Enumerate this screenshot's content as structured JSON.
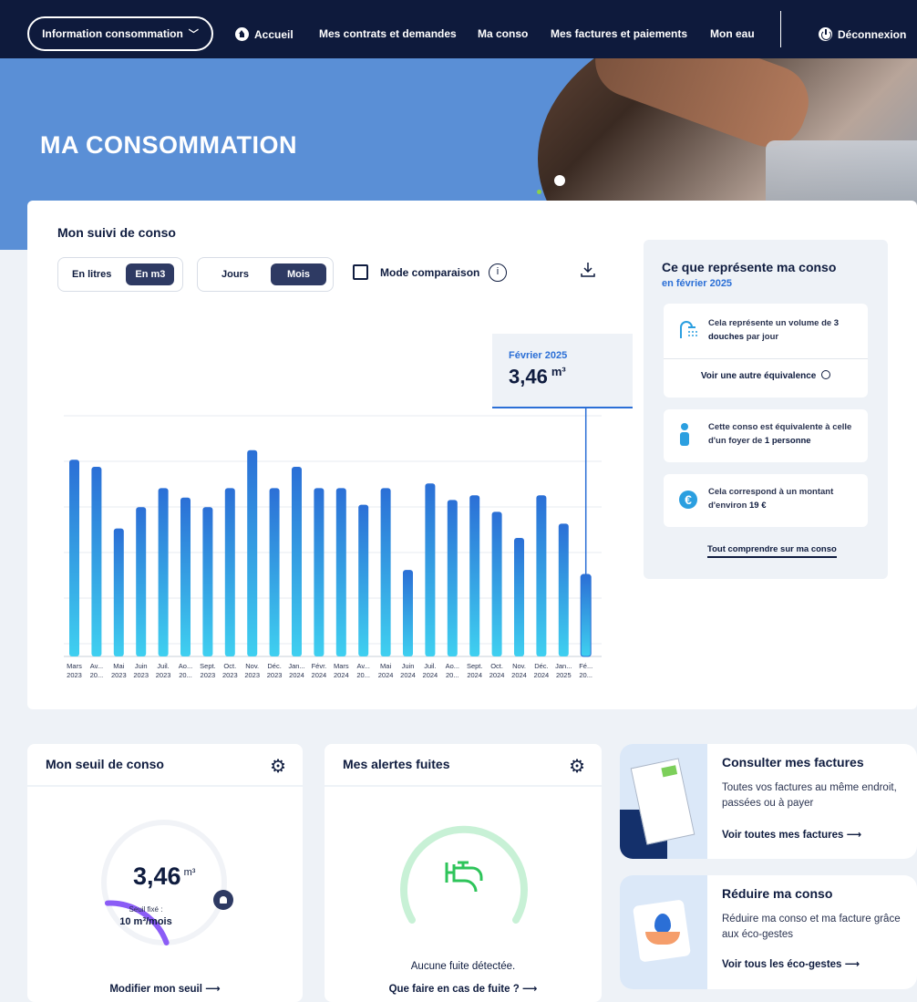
{
  "nav": {
    "info_consommation": "Information consommation",
    "accueil": "Accueil",
    "contrats": "Mes contrats et demandes",
    "ma_conso": "Ma conso",
    "factures": "Mes factures et paiements",
    "mon_eau": "Mon eau",
    "deconnexion": "Déconnexion"
  },
  "hero": {
    "title": "MA CONSOMMATION"
  },
  "suivi": {
    "title": "Mon suivi de conso",
    "unit_toggle": [
      "En litres",
      "En m3"
    ],
    "unit_selected": "En m3",
    "period_toggle": [
      "Jours",
      "Mois"
    ],
    "period_selected": "Mois",
    "comparaison_label": "Mode comparaison",
    "comparaison_checked": false,
    "tooltip": {
      "label": "Février 2025",
      "value": "3,46",
      "unit": "m³"
    }
  },
  "chart_data": {
    "type": "bar",
    "categories": [
      "Mars 2023",
      "Av... 20...",
      "Mai 2023",
      "Juin 2023",
      "Juil. 2023",
      "Ao... 20...",
      "Sept. 2023",
      "Oct. 2023",
      "Nov. 2023",
      "Déc. 2023",
      "Jan... 2024",
      "Févr. 2024",
      "Mars 2024",
      "Av... 20...",
      "Mai 2024",
      "Juin 2024",
      "Juil. 2024",
      "Ao... 20...",
      "Sept. 2024",
      "Oct. 2024",
      "Nov. 2024",
      "Déc. 2024",
      "Jan... 2025",
      "Fé... 20..."
    ],
    "tick_line1": [
      "Mars",
      "Av...",
      "Mai",
      "Juin",
      "Juil.",
      "Ao...",
      "Sept.",
      "Oct.",
      "Nov.",
      "Déc.",
      "Jan...",
      "Févr.",
      "Mars",
      "Av...",
      "Mai",
      "Juin",
      "Juil.",
      "Ao...",
      "Sept.",
      "Oct.",
      "Nov.",
      "Déc.",
      "Jan...",
      "Fé..."
    ],
    "tick_line2": [
      "2023",
      "20...",
      "2023",
      "2023",
      "2023",
      "20...",
      "2023",
      "2023",
      "2023",
      "2023",
      "2024",
      "2024",
      "2024",
      "20...",
      "2024",
      "2024",
      "2024",
      "20...",
      "2024",
      "2024",
      "2024",
      "2024",
      "2025",
      "20..."
    ],
    "values": [
      8.3,
      8.0,
      5.4,
      6.3,
      7.1,
      6.7,
      6.3,
      7.1,
      8.7,
      7.1,
      8.0,
      7.1,
      7.1,
      6.4,
      7.1,
      3.65,
      7.3,
      6.6,
      6.8,
      6.1,
      5.0,
      6.8,
      5.6,
      3.46
    ],
    "highlight_index": 23,
    "ylim": [
      0,
      10
    ],
    "grid": true,
    "colors": {
      "top": "#2b6fd6",
      "bottom": "#3fd0f0"
    }
  },
  "side": {
    "title": "Ce que représente ma conso",
    "subtitle": "en février 2025",
    "eq1_pre": "Cela représente un volume de ",
    "eq1_bold": "3 douches",
    "eq1_post": " par jour",
    "eq1_link": "Voir une autre équivalence",
    "eq2_pre": "Cette conso est équivalente à celle d'un foyer de ",
    "eq2_bold": "1 personne",
    "eq3_pre": "Cela correspond à un montant d'environ ",
    "eq3_bold": "19 €",
    "tout_link": "Tout comprendre sur ma conso"
  },
  "seuil": {
    "title": "Mon seuil de conso",
    "value": "3,46",
    "unit": "m³",
    "seuil_label": "Seuil fixé :",
    "seuil_value": "10 m³/mois",
    "link": "Modifier mon seuil",
    "fraction": 0.346
  },
  "fuites": {
    "title": "Mes alertes fuites",
    "status": "Aucune fuite détectée.",
    "link": "Que faire en cas de fuite ?"
  },
  "factures": {
    "title": "Consulter mes factures",
    "desc": "Toutes vos factures au même endroit, passées ou à payer",
    "link": "Voir toutes mes factures"
  },
  "reduire": {
    "title": "Réduire ma conso",
    "desc": "Réduire ma conso et ma facture grâce aux éco-gestes",
    "link": "Voir tous les éco-gestes"
  }
}
